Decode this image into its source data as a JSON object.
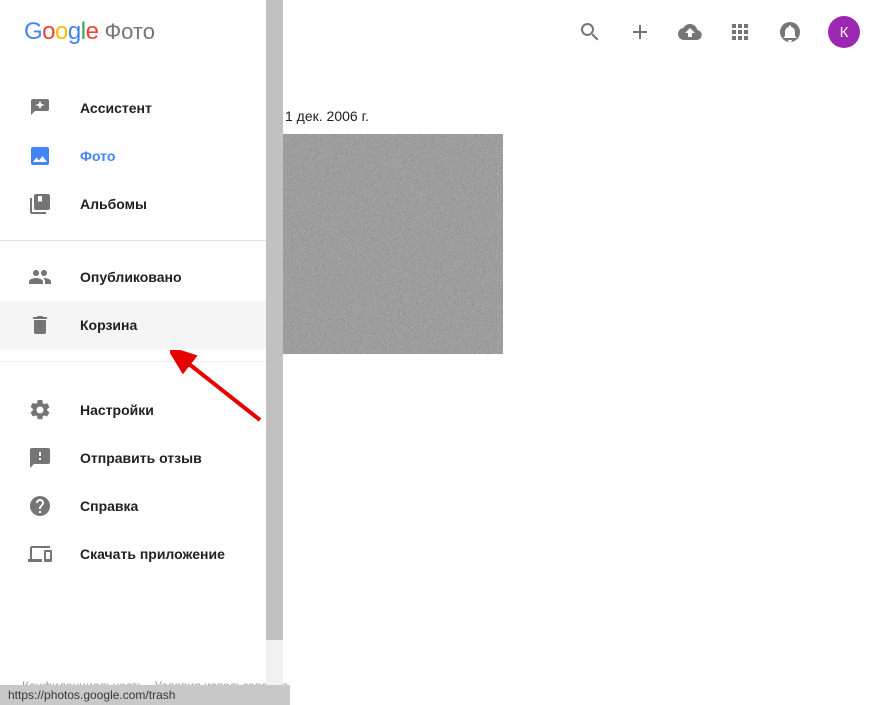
{
  "logo": {
    "word": "Google",
    "suffix": "Фото"
  },
  "nav": {
    "assistant": "Ассистент",
    "photos": "Фото",
    "albums": "Альбомы",
    "shared": "Опубликовано",
    "trash": "Корзина",
    "settings": "Настройки",
    "feedback": "Отправить отзыв",
    "help": "Справка",
    "download_app": "Скачать приложение"
  },
  "footer": {
    "privacy": "Конфиденциальность",
    "dot": " · ",
    "terms": "Условия использования"
  },
  "main": {
    "date_header": "1 дек. 2006 г."
  },
  "avatar_initial": "К",
  "status_url": "https://photos.google.com/trash"
}
